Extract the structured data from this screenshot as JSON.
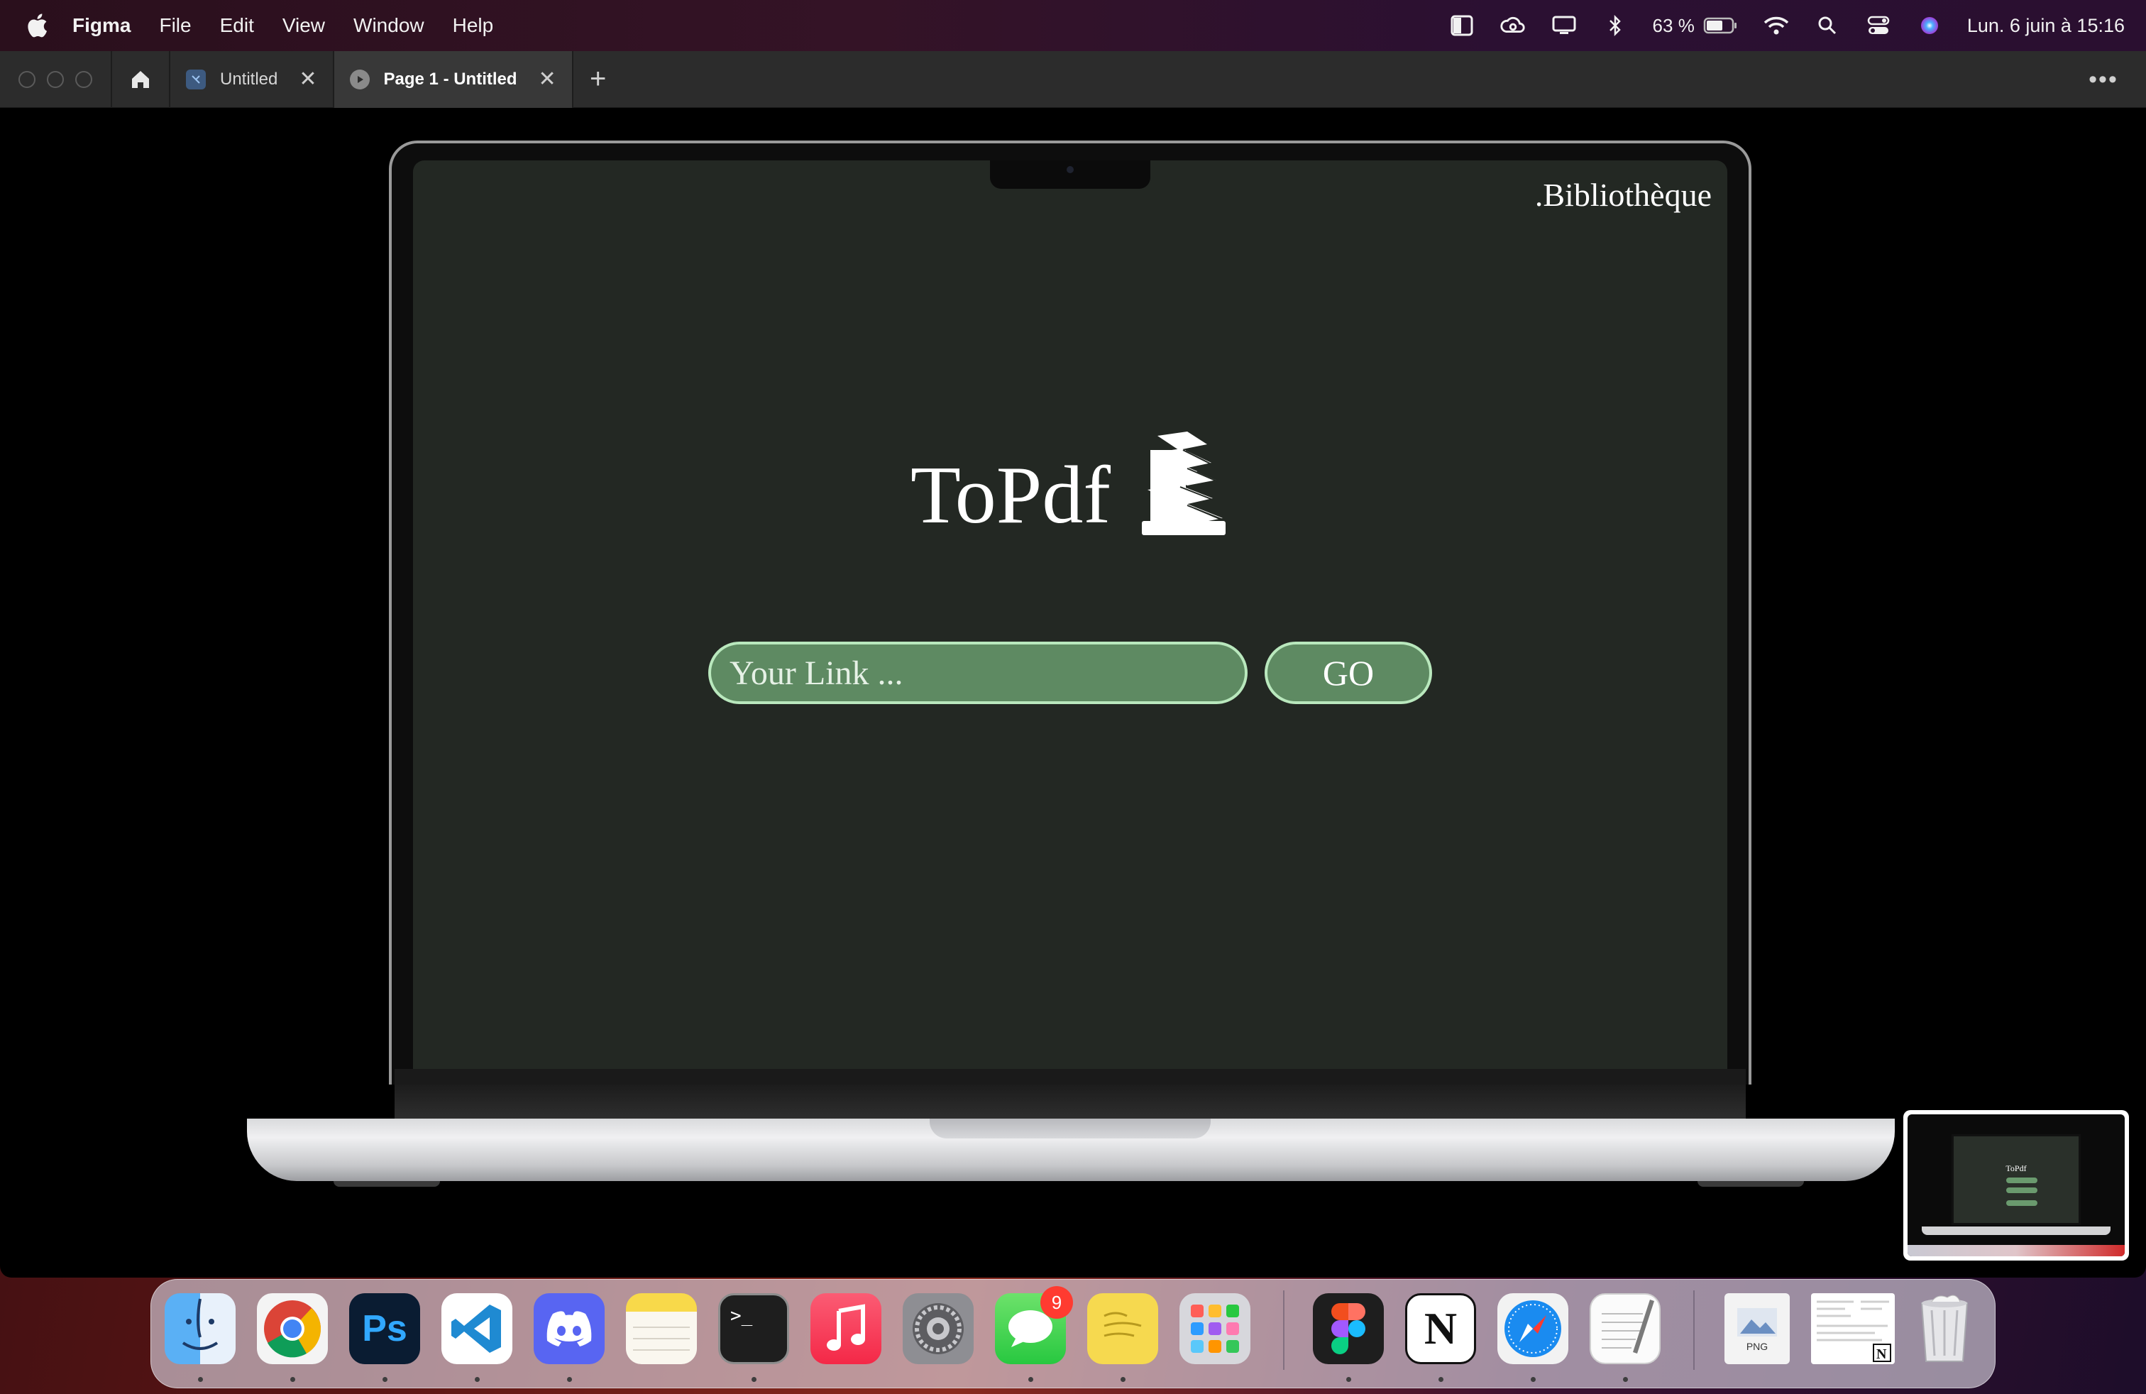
{
  "menubar": {
    "app_name": "Figma",
    "menus": [
      "File",
      "Edit",
      "View",
      "Window",
      "Help"
    ],
    "battery": "63 %",
    "datetime": "Lun. 6 juin à  15:16"
  },
  "tabs": [
    {
      "label": "Untitled",
      "icon": "figma-file-icon",
      "active": false
    },
    {
      "label": "Page 1 - Untitled",
      "icon": "play-prototype-icon",
      "active": true
    }
  ],
  "site": {
    "library_link": ".Bibliothèque",
    "logo": "ToPdf",
    "input_placeholder": "Your Link ...",
    "go_button": "GO"
  },
  "thumbnail": {
    "logo": "ToPdf"
  },
  "dock": {
    "apps": [
      "Finder",
      "Chrome",
      "Photoshop",
      "VS Code",
      "Discord",
      "Notes",
      "Terminal",
      "Music",
      "System Settings",
      "Messages",
      "Stickies",
      "Launchpad",
      "Figma",
      "Notion",
      "Safari",
      "TextEdit",
      "Preview PNG",
      "Notion document",
      "Trash"
    ],
    "messages_badge": "9",
    "png_label": "PNG"
  },
  "colors": {
    "screen_bg": "#232823",
    "input_fill": "#5e8a62",
    "input_border": "#b9e8bd"
  }
}
